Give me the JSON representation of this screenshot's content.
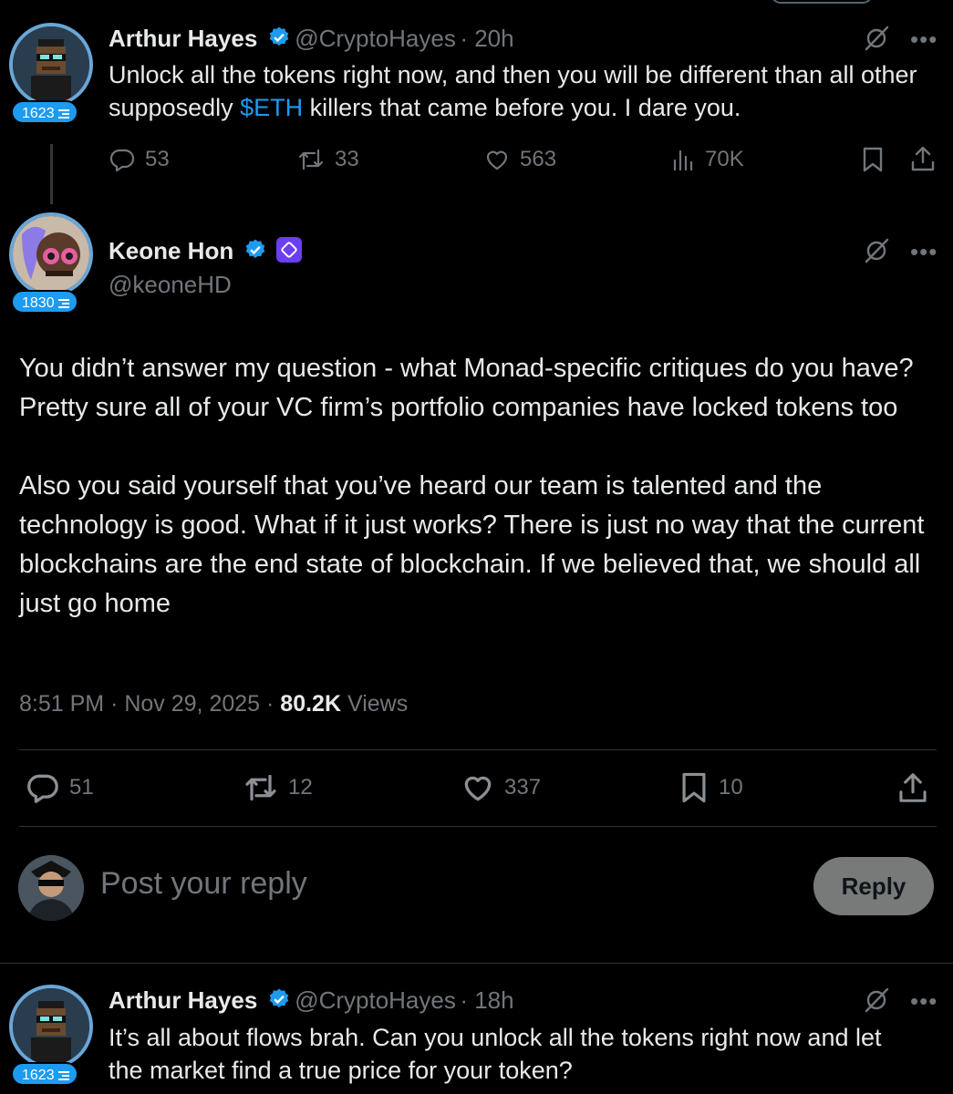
{
  "tweet1": {
    "name": "Arthur Hayes",
    "handle": "@CryptoHayes",
    "time": "20h",
    "badge": "1623",
    "text_a": "Unlock all the tokens right now, and then you will be different than all other supposedly ",
    "cashtag": "$ETH",
    "text_b": " killers that came before you. I dare you.",
    "replies": "53",
    "reposts": "33",
    "likes": "563",
    "views": "70K"
  },
  "main": {
    "name": "Keone Hon",
    "handle": "@keoneHD",
    "badge": "1830",
    "text": "You didn’t answer my question - what Monad-specific critiques do you have? Pretty sure all of your VC firm’s portfolio companies have locked tokens too\n\nAlso you said yourself that you’ve heard our team is talented and the technology is good. What if it just works? There is just no way that the current blockchains are the end state of blockchain. If we believed that, we should all just go home",
    "time": "8:51 PM",
    "date": "Nov 29, 2025",
    "views_count": "80.2K",
    "views_label": "Views",
    "replies": "51",
    "reposts": "12",
    "likes": "337",
    "bookmarks": "10"
  },
  "compose": {
    "placeholder": "Post your reply",
    "button": "Reply"
  },
  "tweet3": {
    "name": "Arthur Hayes",
    "handle": "@CryptoHayes",
    "time": "18h",
    "badge": "1623",
    "text": "It’s all about flows brah. Can you unlock all the tokens right now and let the market find a true price for your token?"
  },
  "colors": {
    "background": "#000000",
    "accent": "#1d9bf0",
    "muted": "#71767b",
    "affiliate": "#6b3ff0"
  },
  "icons": [
    "grok-icon",
    "more-icon",
    "reply-icon",
    "repost-icon",
    "like-icon",
    "views-icon",
    "bookmark-icon",
    "share-icon",
    "verified-icon"
  ]
}
